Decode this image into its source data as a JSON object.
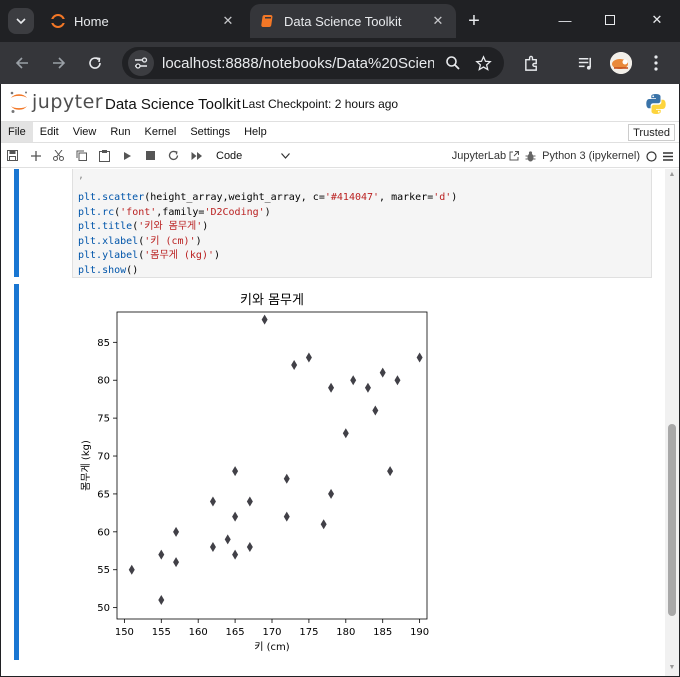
{
  "browser": {
    "tabs": [
      {
        "title": "Home",
        "active": false
      },
      {
        "title": "Data Science Toolkit",
        "active": true
      }
    ],
    "url": "localhost:8888/notebooks/Data%20Scien..."
  },
  "jupyter": {
    "logo_text": "jupyter",
    "notebook_name": "Data Science Toolkit",
    "checkpoint": "Last Checkpoint: 2 hours ago",
    "menu": [
      "File",
      "Edit",
      "View",
      "Run",
      "Kernel",
      "Settings",
      "Help"
    ],
    "trusted": "Trusted",
    "cell_type": "Code",
    "jupyterlab_label": "JupyterLab",
    "kernel": "Python 3 (ipykernel)"
  },
  "code": {
    "lines": [
      {
        "fn": "plt.scatter",
        "rest": "(height_array,weight_array, c=",
        "s1": "'#414047'",
        "rest2": ", marker=",
        "s2": "'d'",
        "end": ")"
      },
      {
        "fn": "plt.rc",
        "rest": "(",
        "s1": "'font'",
        "rest2": ",family=",
        "s2": "'D2Coding'",
        "end": ")"
      },
      {
        "fn": "plt.title",
        "rest": "(",
        "s1": "'키와 몸무게'",
        "rest2": "",
        "s2": "",
        "end": ")"
      },
      {
        "fn": "plt.xlabel",
        "rest": "(",
        "s1": "'키 (cm)'",
        "rest2": "",
        "s2": "",
        "end": ")"
      },
      {
        "fn": "plt.ylabel",
        "rest": "(",
        "s1": "'몸무게 (kg)'",
        "rest2": "",
        "s2": "",
        "end": ")"
      },
      {
        "fn": "plt.show",
        "rest": "()",
        "s1": "",
        "rest2": "",
        "s2": "",
        "end": ""
      }
    ]
  },
  "chart_data": {
    "type": "scatter",
    "title": "키와 몸무게",
    "xlabel": "키 (cm)",
    "ylabel": "몸무게 (kg)",
    "xlim": [
      149,
      191
    ],
    "ylim": [
      48.5,
      89
    ],
    "xticks": [
      150,
      155,
      160,
      165,
      170,
      175,
      180,
      185,
      190
    ],
    "yticks": [
      50,
      55,
      60,
      65,
      70,
      75,
      80,
      85
    ],
    "marker": "d",
    "color": "#414047",
    "grid": false,
    "points": [
      [
        151,
        55
      ],
      [
        155,
        57
      ],
      [
        155,
        51
      ],
      [
        157,
        60
      ],
      [
        157,
        56
      ],
      [
        162,
        64
      ],
      [
        162,
        58
      ],
      [
        164,
        59
      ],
      [
        165,
        68
      ],
      [
        165,
        62
      ],
      [
        165,
        57
      ],
      [
        167,
        64
      ],
      [
        167,
        58
      ],
      [
        169,
        88
      ],
      [
        172,
        67
      ],
      [
        172,
        62
      ],
      [
        173,
        82
      ],
      [
        175,
        83
      ],
      [
        177,
        61
      ],
      [
        178,
        79
      ],
      [
        178,
        65
      ],
      [
        180,
        73
      ],
      [
        181,
        80
      ],
      [
        183,
        79
      ],
      [
        184,
        76
      ],
      [
        185,
        81
      ],
      [
        186,
        68
      ],
      [
        187,
        80
      ],
      [
        190,
        83
      ]
    ]
  }
}
